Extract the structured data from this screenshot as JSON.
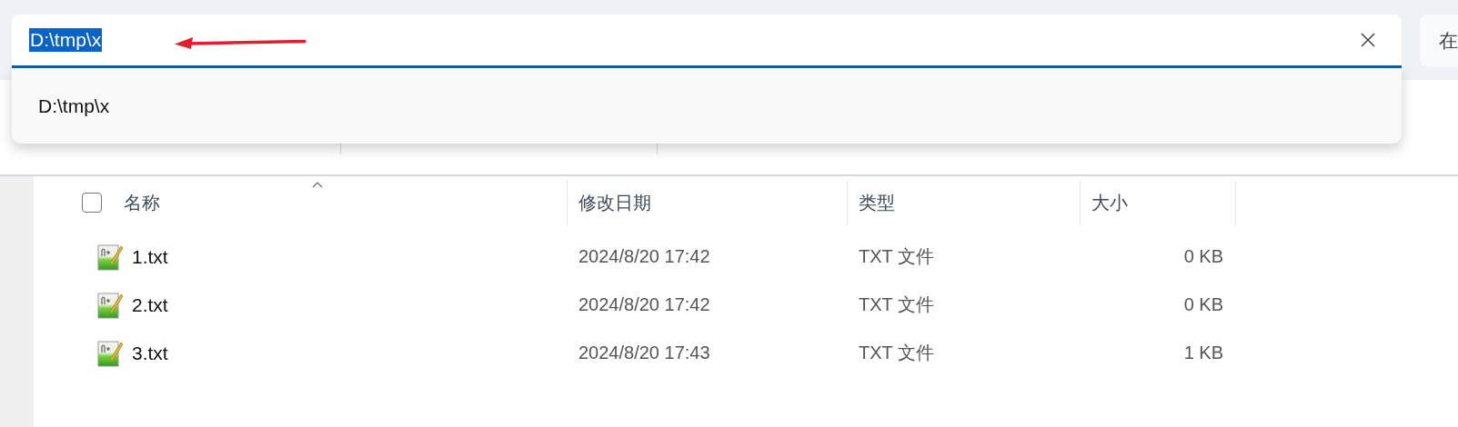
{
  "address_bar": {
    "value": "D:\\tmp\\x",
    "text_selected": true
  },
  "search_box": {
    "label": "在"
  },
  "suggestions": [
    {
      "label": "D:\\tmp\\x"
    }
  ],
  "select_all": {
    "checked": false
  },
  "columns": [
    {
      "label": "名称",
      "sorted": true
    },
    {
      "label": "修改日期",
      "sorted": false
    },
    {
      "label": "类型",
      "sorted": false
    },
    {
      "label": "大小",
      "sorted": false
    }
  ],
  "rows": [
    {
      "name": "1.txt",
      "modified": "2024/8/20 17:42",
      "type": "TXT 文件",
      "size": "0 KB"
    },
    {
      "name": "2.txt",
      "modified": "2024/8/20 17:42",
      "type": "TXT 文件",
      "size": "0 KB"
    },
    {
      "name": "3.txt",
      "modified": "2024/8/20 17:43",
      "type": "TXT 文件",
      "size": "1 KB"
    }
  ]
}
